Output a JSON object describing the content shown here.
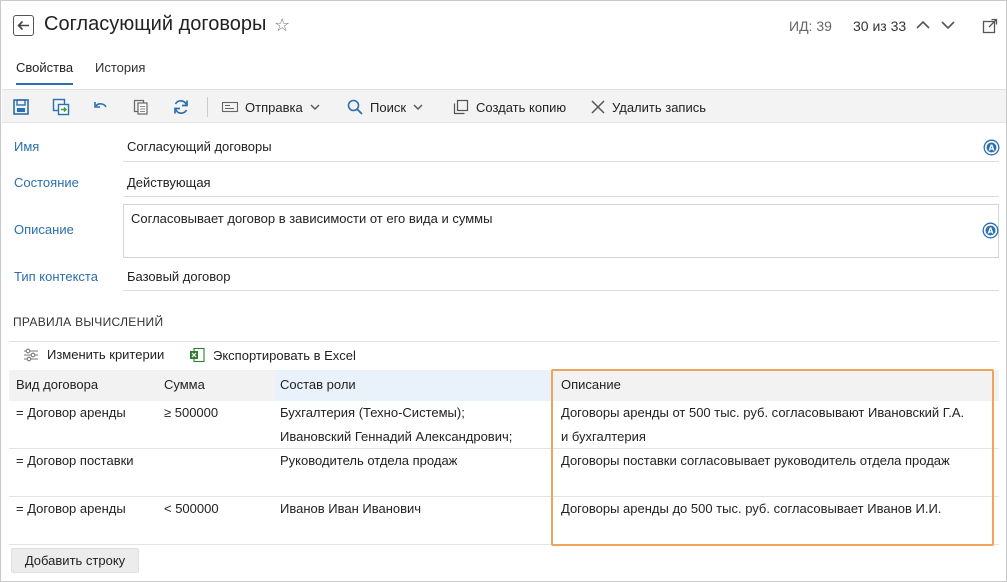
{
  "header": {
    "title": "Согласующий договоры",
    "id_label": "ИД: 39",
    "counter": "30 из 33"
  },
  "tabs": [
    {
      "label": "Свойства",
      "active": true
    },
    {
      "label": "История",
      "active": false
    }
  ],
  "toolbar": {
    "save_icon": "save-icon",
    "save_close_icon": "save-close-icon",
    "undo_icon": "undo-icon",
    "copy_icon": "copy-icon",
    "refresh_icon": "refresh-icon",
    "send_label": "Отправка",
    "search_label": "Поиск",
    "create_copy_label": "Создать копию",
    "delete_label": "Удалить запись"
  },
  "fields": {
    "name_label": "Имя",
    "name_value": "Согласующий договоры",
    "state_label": "Состояние",
    "state_value": "Действующая",
    "description_label": "Описание",
    "description_value": "Согласовывает договор в зависимости от его вида и суммы",
    "context_label": "Тип контекста",
    "context_value": "Базовый договор"
  },
  "rules": {
    "section_title": "ПРАВИЛА ВЫЧИСЛЕНИЙ",
    "change_criteria_label": "Изменить критерии",
    "export_label": "Экспортировать в Excel",
    "columns": [
      "Вид договора",
      "Сумма",
      "Состав роли",
      "Описание"
    ],
    "rows": [
      {
        "type": "= Договор аренды",
        "sum": "≥ 500000",
        "role_1": "Бухгалтерия (Техно-Системы);",
        "role_2": "Ивановский Геннадий Александрович;",
        "desc_1": "Договоры аренды от 500 тыс. руб. согласовывают Ивановский Г.А.",
        "desc_2": "и бухгалтерия"
      },
      {
        "type": "= Договор поставки",
        "sum": "",
        "role_1": "Руководитель отдела продаж",
        "role_2": "",
        "desc_1": "Договоры поставки согласовывает руководитель отдела продаж",
        "desc_2": ""
      },
      {
        "type": "= Договор аренды",
        "sum": "< 500000",
        "role_1": "Иванов Иван Иванович",
        "role_2": "",
        "desc_1": "Договоры аренды до 500 тыс. руб. согласовывает Иванов И.И.",
        "desc_2": ""
      }
    ],
    "add_row_label": "Добавить строку"
  },
  "colors": {
    "accent": "#2a6fb0",
    "highlight_border": "#f0a35a"
  }
}
